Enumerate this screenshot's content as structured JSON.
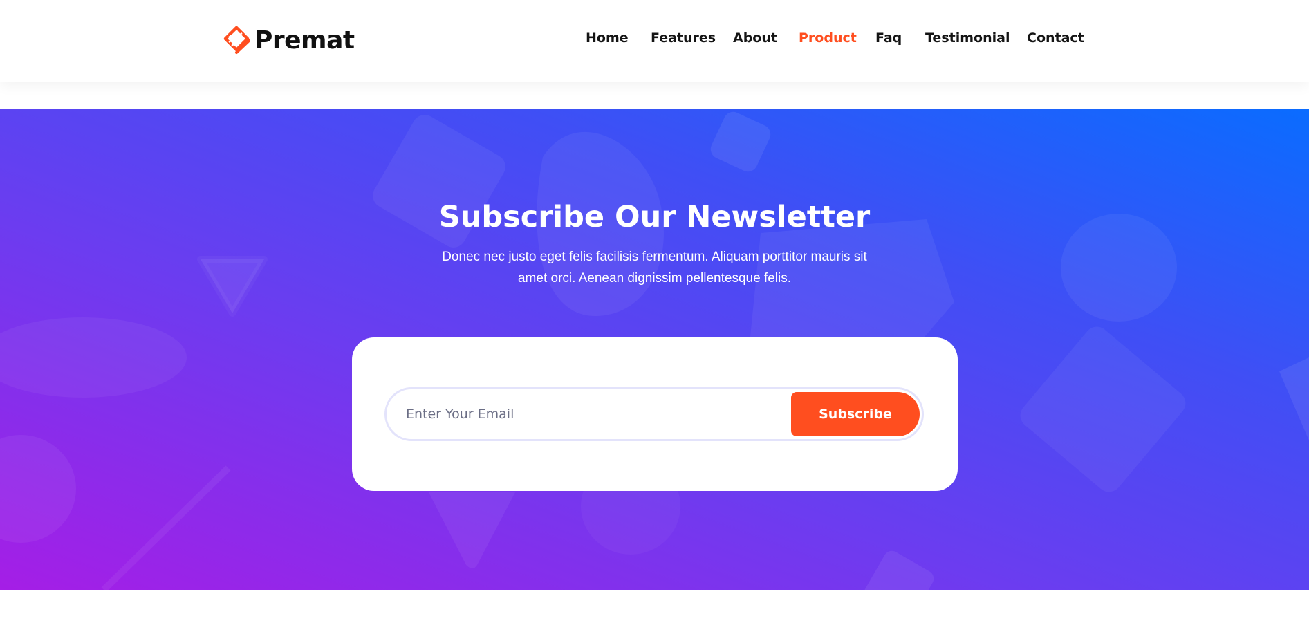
{
  "brand": {
    "name": "Premat",
    "accent": "#ff4e1f"
  },
  "nav": {
    "items": [
      {
        "label": "Home"
      },
      {
        "label": "Features"
      },
      {
        "label": "About"
      },
      {
        "label": "Product"
      },
      {
        "label": "Faq"
      },
      {
        "label": "Testimonial"
      },
      {
        "label": "Contact"
      }
    ],
    "active": "Product"
  },
  "newsletter": {
    "title": "Subscribe Our Newsletter",
    "description": "Donec nec justo eget felis facilisis fermentum. Aliquam porttitor mauris sit amet orci. Aenean dignissim pellentesque felis.",
    "email_placeholder": "Enter Your Email",
    "button_label": "Subscribe"
  },
  "colors": {
    "gradient_top_right": "#0a6cff",
    "gradient_bottom_left": "#a51ee6",
    "text_dark": "#141414"
  }
}
